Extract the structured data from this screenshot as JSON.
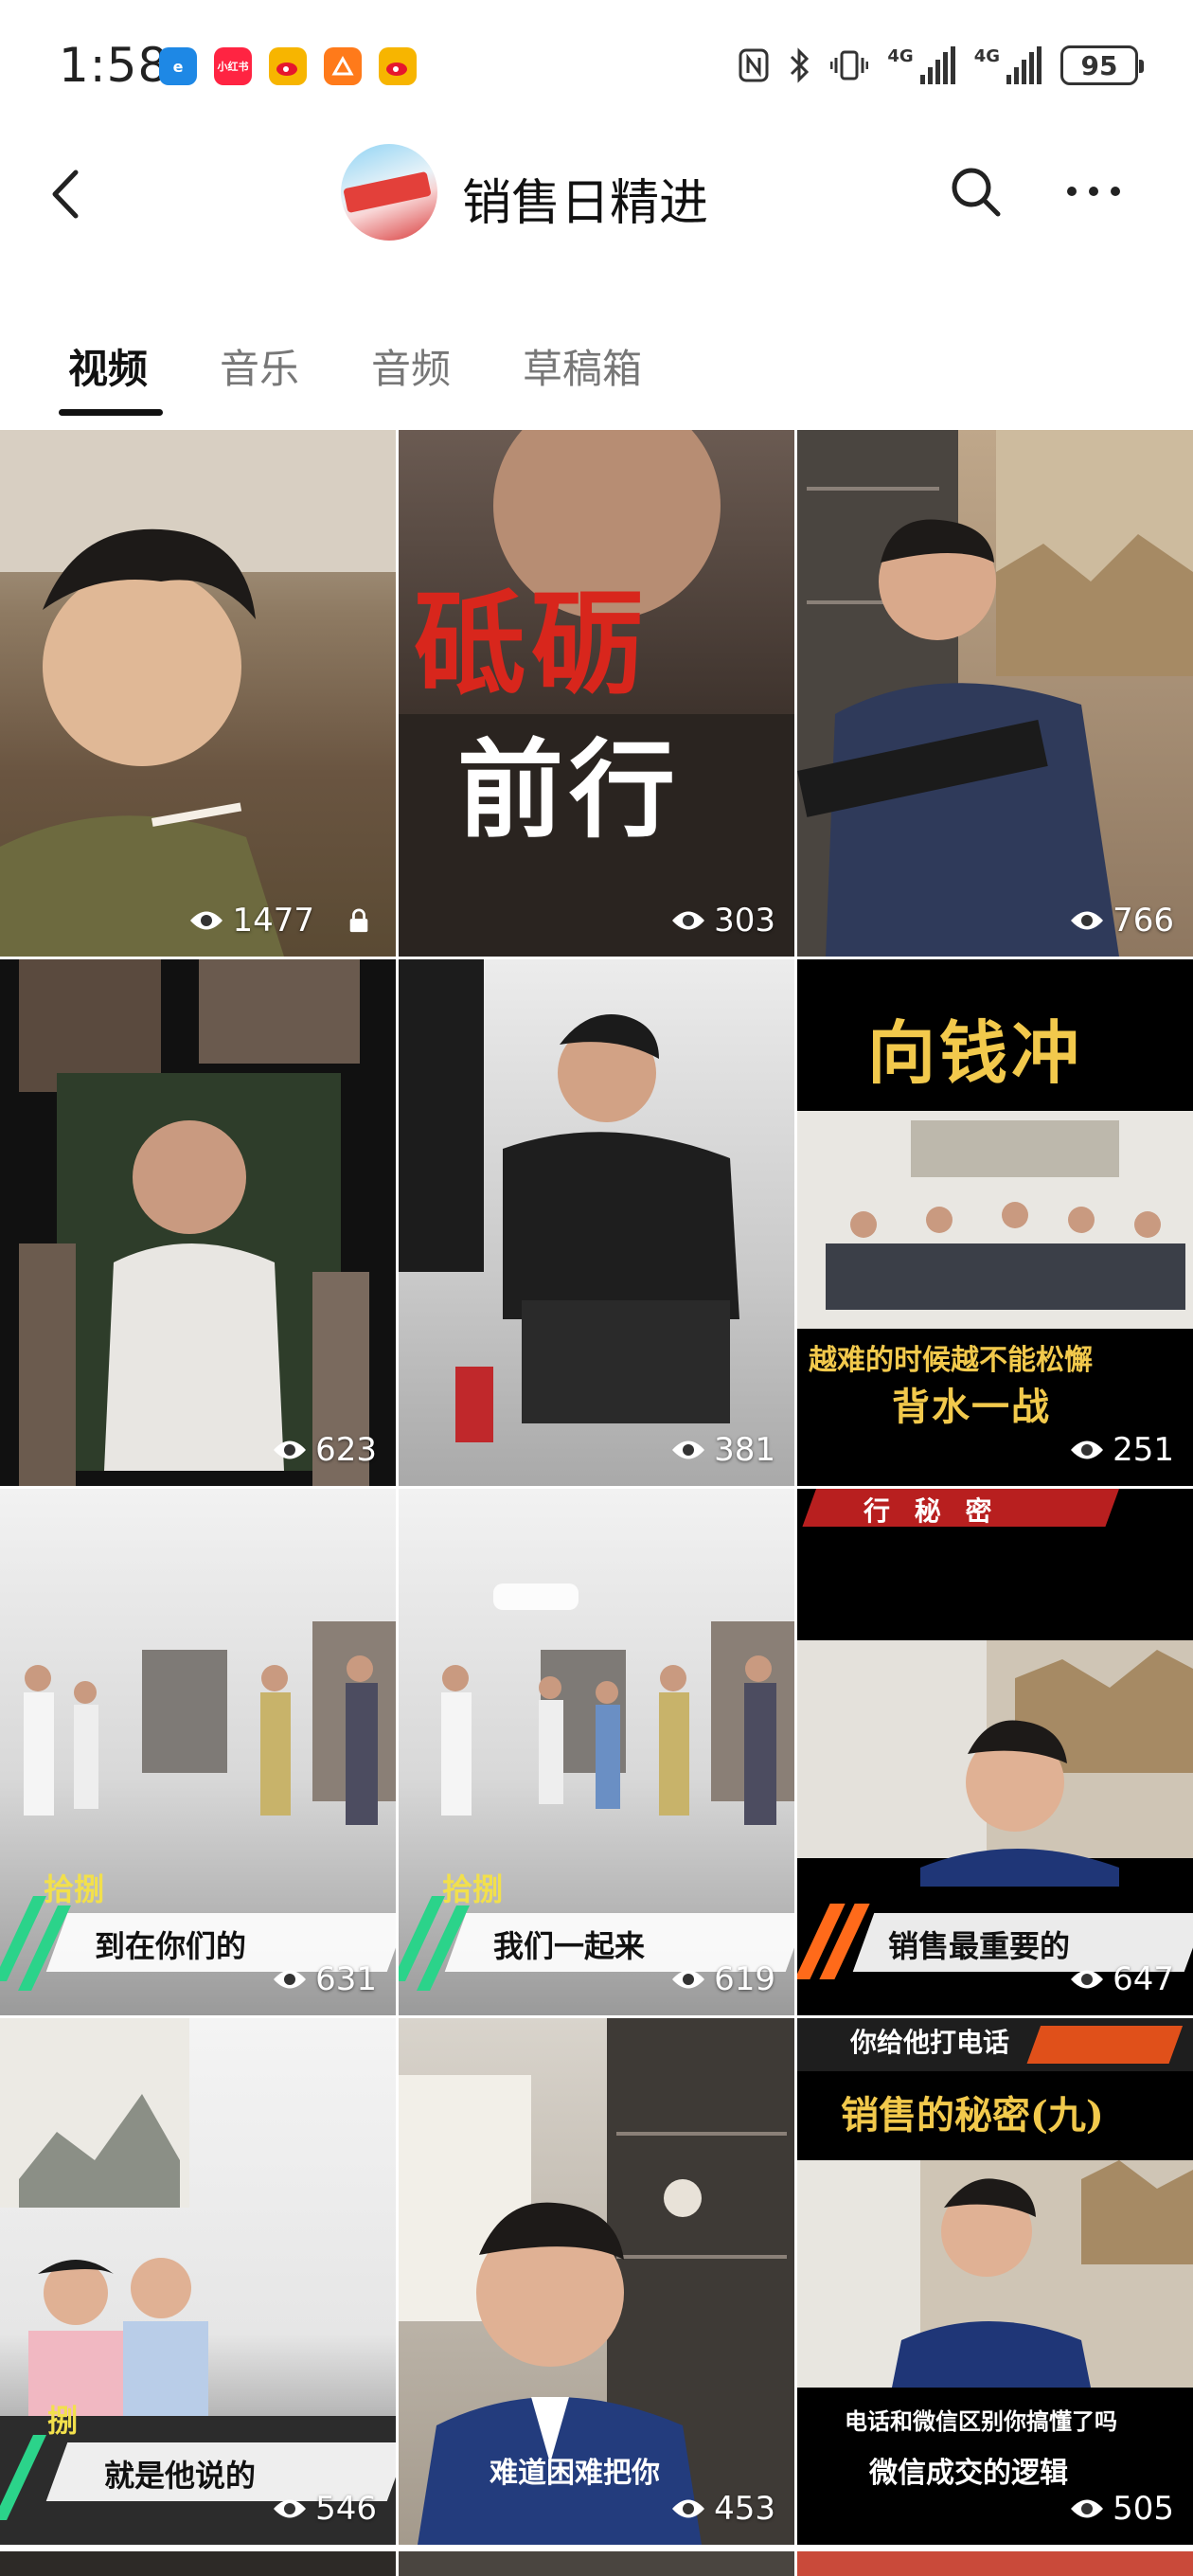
{
  "status_bar": {
    "time": "1:58",
    "app_icons": [
      {
        "name": "browser-icon",
        "color": "#1e88e5",
        "glyph": "e"
      },
      {
        "name": "xiaohongshu-icon",
        "color": "#ff2442",
        "glyph": "小红书"
      },
      {
        "name": "weibo-icon",
        "color": "#f7b500",
        "glyph": "微"
      },
      {
        "name": "app-orange-icon",
        "color": "#ff7a1a",
        "glyph": "△"
      },
      {
        "name": "weibo-icon-2",
        "color": "#f7b500",
        "glyph": "微"
      }
    ],
    "network_label_1": "4G",
    "network_label_2": "4G",
    "battery": "95"
  },
  "header": {
    "title": "销售日精进"
  },
  "tabs": [
    {
      "label": "视频",
      "active": true
    },
    {
      "label": "音乐",
      "active": false
    },
    {
      "label": "音频",
      "active": false
    },
    {
      "label": "草稿箱",
      "active": false
    }
  ],
  "videos": [
    {
      "views": "1477",
      "locked": true
    },
    {
      "views": "303",
      "caption_top": "砥砺",
      "caption_bottom": "前行"
    },
    {
      "views": "766"
    },
    {
      "views": "623"
    },
    {
      "views": "381"
    },
    {
      "views": "251",
      "caption_top": "向钱冲",
      "caption_mid": "越难的时候越不能松懈",
      "caption_bottom": "背水一战"
    },
    {
      "views": "631",
      "tag": "拾捌",
      "bar_text": "到在你们的"
    },
    {
      "views": "619",
      "tag": "拾捌",
      "bar_text": "我们一起来"
    },
    {
      "views": "647",
      "top_text": "行 秘 密",
      "bar_text": "销售最重要的"
    },
    {
      "views": "546",
      "tag": "捌",
      "bar_text": "就是他说的"
    },
    {
      "views": "453",
      "bar_text": "难道困难把你"
    },
    {
      "views": "505",
      "top_small": "你给他打电话",
      "caption_top": "销售的秘密(九)",
      "caption_mid": "电话和微信区别你搞懂了吗",
      "bar_text": "微信成交的逻辑"
    }
  ]
}
